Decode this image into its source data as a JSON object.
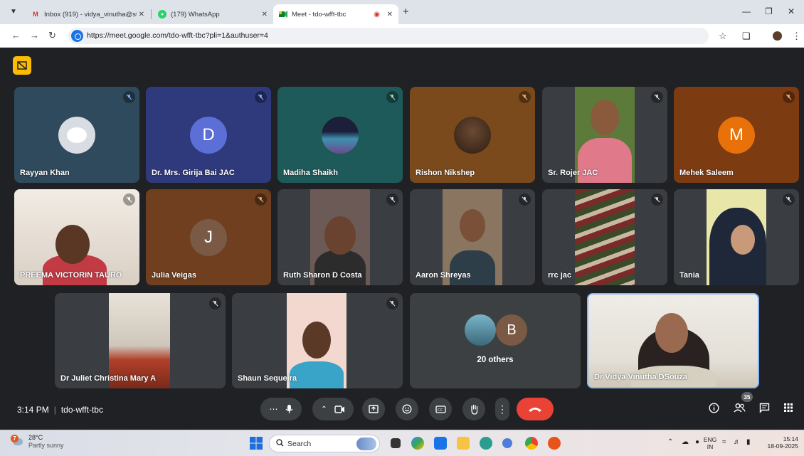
{
  "browser": {
    "tabs": [
      {
        "title": "Inbox (919) - vidya_vinutha@st",
        "icon": "gmail-icon"
      },
      {
        "title": "(179) WhatsApp",
        "icon": "whatsapp-icon"
      },
      {
        "title": "Meet - tdo-wfft-tbc",
        "icon": "meet-icon",
        "active": true
      }
    ],
    "url": "https://meet.google.com/tdo-wfft-tbc?pli=1&authuser=4"
  },
  "meeting": {
    "time": "3:14 PM",
    "code": "tdo-wfft-tbc",
    "participant_count": "35",
    "participants": [
      {
        "name": "Rayyan Khan",
        "kind": "image-avatar"
      },
      {
        "name": "Dr. Mrs. Girija Bai JAC",
        "kind": "letter-avatar",
        "letter": "D"
      },
      {
        "name": "Madiha Shaikh",
        "kind": "image-avatar"
      },
      {
        "name": "Rishon Nikshep",
        "kind": "image-avatar"
      },
      {
        "name": "Sr. Rojer JAC",
        "kind": "video"
      },
      {
        "name": "Mehek Saleem",
        "kind": "letter-avatar",
        "letter": "M"
      },
      {
        "name": "PREEMA VICTORIN TAURO",
        "kind": "video"
      },
      {
        "name": "Julia Veigas",
        "kind": "letter-avatar",
        "letter": "J"
      },
      {
        "name": "Ruth Sharon D Costa",
        "kind": "video"
      },
      {
        "name": "Aaron Shreyas",
        "kind": "video"
      },
      {
        "name": "rrc jac",
        "kind": "video"
      },
      {
        "name": "Tania",
        "kind": "video"
      },
      {
        "name": "Dr Juliet Christina Mary A",
        "kind": "video"
      },
      {
        "name": "Shaun Sequeira",
        "kind": "video"
      },
      {
        "name": "Dr Vidya Vinutha DSouza",
        "kind": "video"
      }
    ],
    "others": {
      "label": "20 others",
      "letter": "B"
    }
  },
  "taskbar": {
    "temperature": "28°C",
    "condition": "Partly sunny",
    "weather_badge": "7",
    "search_placeholder": "Search",
    "language": "ENG",
    "region": "IN",
    "clock_time": "15:14",
    "clock_date": "18-09-2025"
  },
  "colors": {
    "meet_bg": "#202124",
    "end_call": "#ea4335",
    "pip_button": "#fbbc04",
    "avatar_blue": "#5b6fd6",
    "avatar_orange": "#e8710a",
    "avatar_brown": "#7a5a45"
  }
}
